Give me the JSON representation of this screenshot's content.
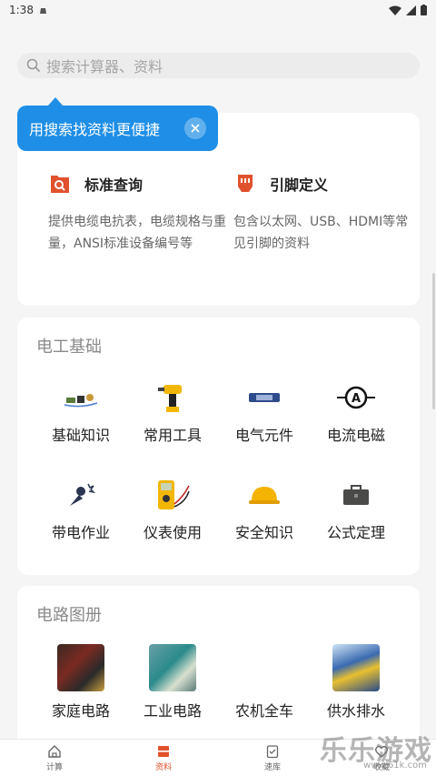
{
  "status": {
    "time": "1:38"
  },
  "search": {
    "placeholder": "搜索计算器、资料"
  },
  "tooltip": {
    "text": "用搜索找资料更便捷"
  },
  "features": [
    {
      "title": "标准查询",
      "desc": "提供电缆电抗表，电缆规格与重量，ANSI标准设备编号等",
      "icon": "search-doc-icon",
      "color": "#e0522d"
    },
    {
      "title": "引脚定义",
      "desc": "包含以太网、USB、HDMI等常见引脚的资料",
      "icon": "connector-pin-icon",
      "color": "#e0522d"
    }
  ],
  "section1": {
    "title": "电工基础",
    "items": [
      {
        "label": "基础知识",
        "icon": "circuit-basics-icon"
      },
      {
        "label": "常用工具",
        "icon": "drill-icon"
      },
      {
        "label": "电气元件",
        "icon": "component-board-icon"
      },
      {
        "label": "电流电磁",
        "icon": "ammeter-icon"
      },
      {
        "label": "带电作业",
        "icon": "live-work-icon"
      },
      {
        "label": "仪表使用",
        "icon": "multimeter-icon"
      },
      {
        "label": "安全知识",
        "icon": "hard-hat-icon"
      },
      {
        "label": "公式定理",
        "icon": "toolbox-icon"
      }
    ]
  },
  "section2": {
    "title": "电路图册",
    "items": [
      {
        "label": "家庭电路",
        "icon": "home-wiring-photo"
      },
      {
        "label": "工业电路",
        "icon": "industrial-board-photo"
      },
      {
        "label": "农机全车",
        "icon": ""
      },
      {
        "label": "供水排水",
        "icon": "water-plant-photo"
      }
    ]
  },
  "tabs": [
    {
      "label": "计算",
      "icon": "home-icon",
      "active": false
    },
    {
      "label": "资料",
      "icon": "document-icon",
      "active": true
    },
    {
      "label": "速库",
      "icon": "clipboard-check-icon",
      "active": false
    },
    {
      "label": "收藏",
      "icon": "heart-icon",
      "active": false
    }
  ],
  "watermark": {
    "text": "乐乐游戏",
    "url": "www.61k.com"
  },
  "colors": {
    "accent": "#e0522d",
    "tooltip": "#1e8ee6"
  }
}
